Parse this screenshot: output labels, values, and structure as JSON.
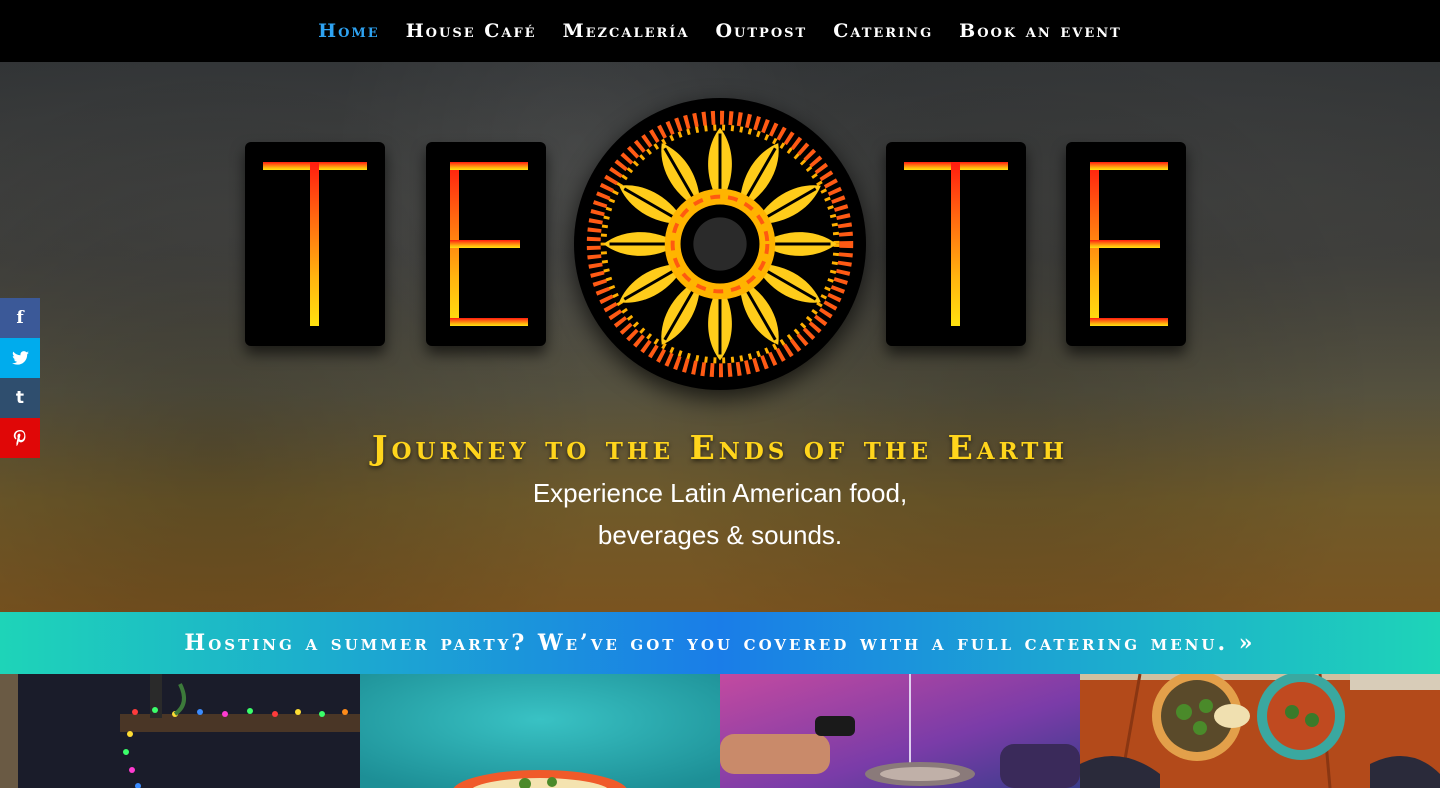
{
  "nav": {
    "items": [
      {
        "label": "Home",
        "active": true
      },
      {
        "label": "House Café",
        "active": false
      },
      {
        "label": "Mezcalería",
        "active": false
      },
      {
        "label": "Outpost",
        "active": false
      },
      {
        "label": "Catering",
        "active": false
      },
      {
        "label": "Book an event",
        "active": false
      }
    ]
  },
  "hero": {
    "logo_text": "TEOTE",
    "tagline": "Journey to the Ends of the Earth",
    "sub_line1": "Experience Latin American food,",
    "sub_line2": "beverages & sounds."
  },
  "social": [
    {
      "name": "facebook",
      "glyph": "f",
      "color": "#3b5998"
    },
    {
      "name": "twitter",
      "glyph": "✓",
      "color": "#00aced"
    },
    {
      "name": "tumblr",
      "glyph": "t",
      "color": "#2f4e6e"
    },
    {
      "name": "pinterest",
      "glyph": "P",
      "color": "#e00707"
    }
  ],
  "cta": {
    "text": "Hosting a summer party? We’ve got you covered with a full catering menu. »",
    "gradient_colors": [
      "#1ed4b8",
      "#1a7de8",
      "#1ed4b8"
    ]
  },
  "colors": {
    "nav_active": "#2ea3f2",
    "tagline": "#ffd51c",
    "logo_gradient_top": "#ff1c0f",
    "logo_gradient_bottom": "#ffe20f"
  }
}
